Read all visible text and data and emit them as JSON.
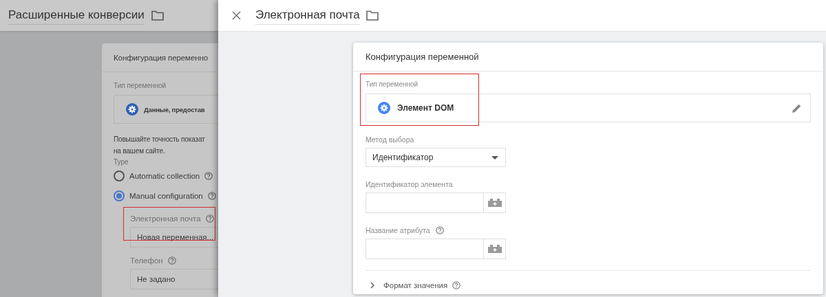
{
  "background_pane": {
    "title": "Расширенные конверсии",
    "card": {
      "title": "Конфигурация переменно",
      "type_label": "Тип переменной",
      "type_value": "Данные, предостав",
      "description": [
        "Повышайте точность показат",
        "на вашем сайте."
      ],
      "type_heading": "Type",
      "options": [
        {
          "label": "Automatic collection",
          "selected": false,
          "help": true
        },
        {
          "label": "Manual configuration",
          "selected": true,
          "help": true
        }
      ],
      "fields": [
        {
          "label": "Электронная почта",
          "value": "Новая переменная...",
          "help": true,
          "highlighted": true
        },
        {
          "label": "Телефон",
          "value": "Не задано",
          "help": true,
          "highlighted": false
        }
      ]
    }
  },
  "panel": {
    "title": "Электронная почта",
    "card": {
      "title": "Конфигурация переменной",
      "type_label": "Тип переменной",
      "type_value": "Элемент DOM",
      "type_highlighted": true,
      "fields": [
        {
          "kind": "dropdown",
          "label": "Метод выбора",
          "value": "Идентификатор",
          "help": false
        },
        {
          "kind": "variable",
          "label": "Идентификатор элемента",
          "help": false
        },
        {
          "kind": "variable",
          "label": "Название атрибута",
          "help": true
        }
      ],
      "section": {
        "label": "Формат значения",
        "help": true,
        "expanded": false
      }
    }
  }
}
